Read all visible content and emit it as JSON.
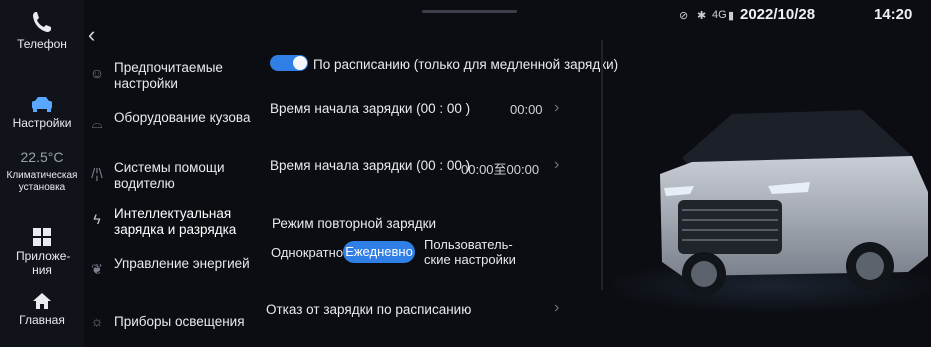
{
  "status_bar": {
    "network": "4G",
    "date": "2022/10/28",
    "time": "14:20"
  },
  "rail": {
    "phone_label": "Телефон",
    "settings_label": "Настройки",
    "climate_temp": "22.5°C",
    "climate_label": "Климатическая установка",
    "apps_label": "Приложе-ния",
    "home_label": "Главная"
  },
  "menu": {
    "items": [
      {
        "label": "Предпочитаемые настройки",
        "icon": "smile-icon"
      },
      {
        "label": "Оборудование кузова",
        "icon": "car-body-icon"
      },
      {
        "label": "Системы помощи водителю",
        "icon": "lane-icon"
      },
      {
        "label": "Интеллектуальная зарядка и разрядка",
        "icon": "lightning-icon"
      },
      {
        "label": "Управление энергией",
        "icon": "leaf-icon"
      },
      {
        "label": "Приборы освещения",
        "icon": "bulb-icon"
      }
    ]
  },
  "settings": {
    "schedule_toggle_label": "По расписанию (только для медленной зарядки)",
    "schedule_toggle_on": true,
    "start_time_label": "Время начала зарядки (00 : 00 )",
    "start_time_value": "00:00",
    "range_label": "Время начала зарядки (00 : 00 )",
    "range_value": "00:00至00:00",
    "repeat_mode_label": "Режим повторной зарядки",
    "repeat_options": [
      "Однократно",
      "Ежедневно",
      "Пользователь-ские настройки"
    ],
    "repeat_selected": "Ежедневно",
    "cancel_label": "Отказ от зарядки по расписанию"
  },
  "colors": {
    "accent": "#2f7fe6",
    "rail_selected": "#5aa7ff",
    "background": "#0b0d12"
  }
}
